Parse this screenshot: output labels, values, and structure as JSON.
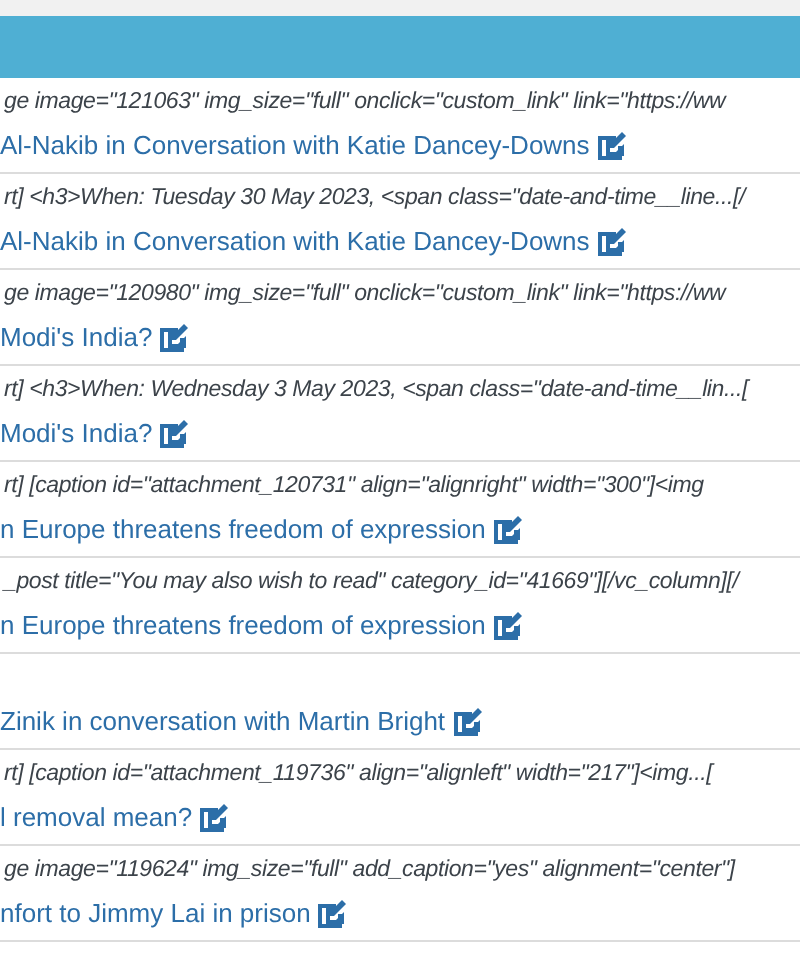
{
  "rows": [
    {
      "snippet": "ge image=\"121063\" img_size=\"full\" onclick=\"custom_link\" link=\"https://ww",
      "title": "Al-Nakib in Conversation with Katie Dancey-Downs"
    },
    {
      "snippet": "rt] <h3>When: Tuesday 30 May 2023, <span class=\"date-and-time__line...[/",
      "title": "Al-Nakib in Conversation with Katie Dancey-Downs"
    },
    {
      "snippet": "ge image=\"120980\" img_size=\"full\" onclick=\"custom_link\" link=\"https://ww",
      "title": "Modi's India?"
    },
    {
      "snippet": "rt] <h3>When: Wednesday 3 May 2023, <span class=\"date-and-time__lin...[",
      "title": "Modi's India?"
    },
    {
      "snippet": "rt] [caption id=\"attachment_120731\" align=\"alignright\" width=\"300\"]<img",
      "title": "n Europe threatens freedom of expression"
    },
    {
      "snippet": "_post title=\"You may also wish to read\" category_id=\"41669\"][/vc_column][/",
      "title": "n Europe threatens freedom of expression"
    },
    {
      "title": "Zinik in conversation with Martin Bright"
    },
    {
      "snippet": "rt] [caption id=\"attachment_119736\" align=\"alignleft\" width=\"217\"]<img...[",
      "title": "l removal mean?"
    },
    {
      "snippet": "ge image=\"119624\" img_size=\"full\" add_caption=\"yes\" alignment=\"center\"]",
      "title": "nfort to Jimmy Lai in prison"
    }
  ]
}
